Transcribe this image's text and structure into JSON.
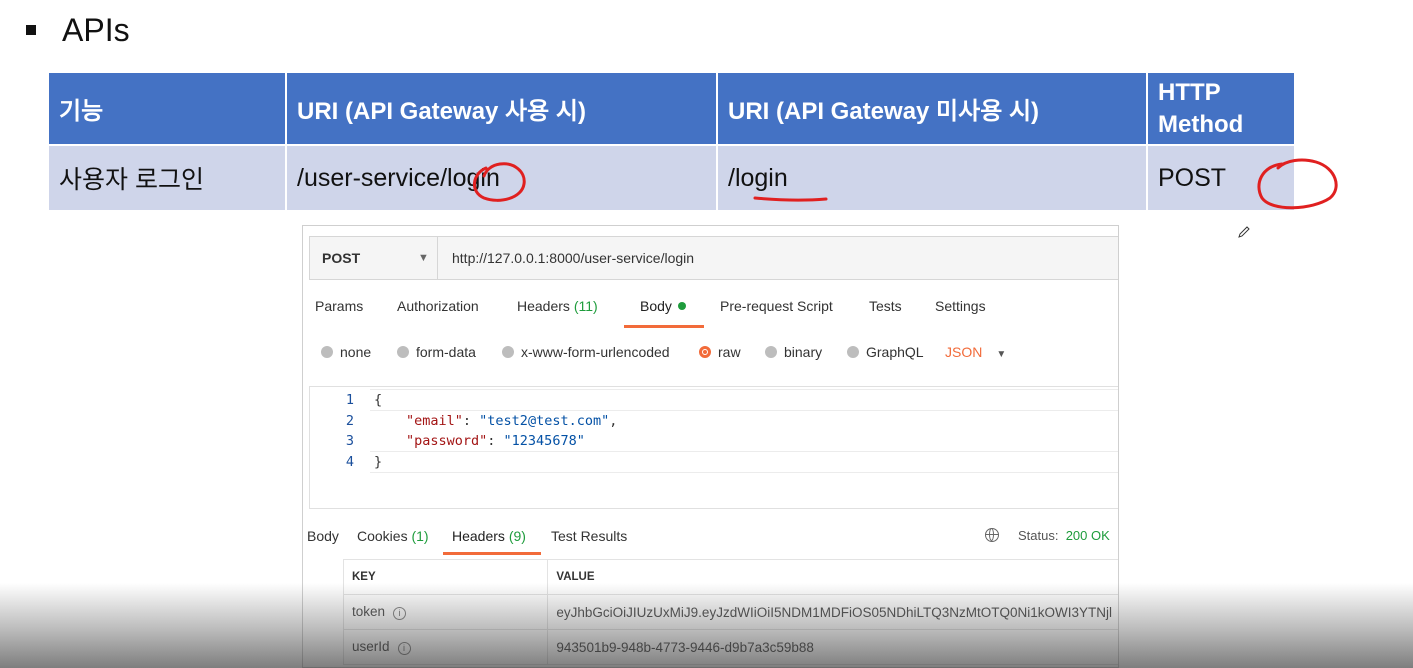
{
  "slide": {
    "title": "APIs"
  },
  "table": {
    "headers": [
      "기능",
      "URI (API Gateway 사용 시)",
      "URI (API Gateway 미사용 시)",
      "HTTP Method"
    ],
    "row": {
      "feature": "사용자 로그인",
      "uri_gateway": "/user-service/login",
      "uri_direct": "/login",
      "method": "POST"
    }
  },
  "postman": {
    "method": "POST",
    "url": "http://127.0.0.1:8000/user-service/login",
    "tabs": [
      {
        "label": "Params"
      },
      {
        "label": "Authorization"
      },
      {
        "label": "Headers",
        "count": "(11)"
      },
      {
        "label": "Body"
      },
      {
        "label": "Pre-request Script"
      },
      {
        "label": "Tests"
      },
      {
        "label": "Settings"
      }
    ],
    "body_types": [
      "none",
      "form-data",
      "x-www-form-urlencoded",
      "raw",
      "binary",
      "GraphQL"
    ],
    "selected_body_type": "raw",
    "raw_format": "JSON",
    "code": {
      "line_numbers": [
        "1",
        "2",
        "3",
        "4"
      ],
      "open": "{",
      "close": "}",
      "email_key": "\"email\"",
      "email_value": "\"test2@test.com\"",
      "password_key": "\"password\"",
      "password_value": "\"12345678\""
    },
    "response_tabs": [
      {
        "label": "Body"
      },
      {
        "label": "Cookies",
        "count": "(1)"
      },
      {
        "label": "Headers",
        "count": "(9)"
      },
      {
        "label": "Test Results"
      }
    ],
    "status_label": "Status:",
    "status_value": "200 OK",
    "headers_table": {
      "columns": [
        "KEY",
        "VALUE"
      ],
      "rows": [
        {
          "key": "token",
          "value": "eyJhbGciOiJIUzUxMiJ9.eyJzdWIiOiI5NDM1MDFiOS05NDhiLTQ3NzMtOTQ0Ni1kOWI3YTNjl"
        },
        {
          "key": "userId",
          "value": "943501b9-948b-4773-9446-d9b7a3c59b88"
        }
      ]
    }
  },
  "colors": {
    "header_blue": "#4472c4",
    "row_lavender": "#cfd5ea",
    "accent_orange": "#f26b3a",
    "ok_green": "#1e9c3c",
    "annotation_red": "#e02020"
  }
}
